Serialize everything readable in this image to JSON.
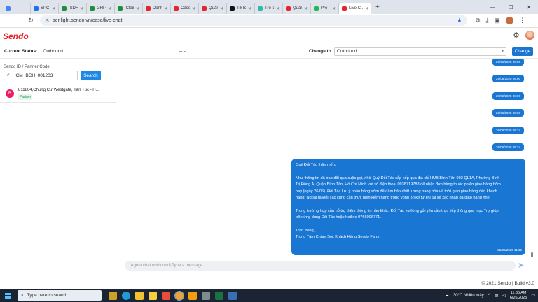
{
  "browser": {
    "tabs": [
      {
        "label": "",
        "color": "#4285f4",
        "type": "gmail",
        "active": false
      },
      {
        "label": "SPC - ...",
        "color": "#1a73e8",
        "active": false
      },
      {
        "label": "[SDF C...",
        "color": "#1e8e3e",
        "active": false
      },
      {
        "label": "GHI C...",
        "color": "#1e8e3e",
        "active": false
      },
      {
        "label": "[Claim...",
        "color": "#1e8e3e",
        "active": false
      },
      {
        "label": "Danh ...",
        "color": "#e4262c",
        "active": false
      },
      {
        "label": "Case ...",
        "color": "#e4262c",
        "active": false
      },
      {
        "label": "Quản ...",
        "color": "#e4262c",
        "active": false
      },
      {
        "label": "TikTok",
        "color": "#111111",
        "active": false
      },
      {
        "label": "Trò ch...",
        "color": "#2bbbad",
        "active": false
      },
      {
        "label": "Quản ...",
        "color": "#e4262c",
        "active": false
      },
      {
        "label": "Pre - ...",
        "color": "#1db954",
        "active": false
      },
      {
        "label": "Live C...",
        "color": "#e4262c",
        "active": true
      }
    ],
    "url": "senlight.sendo.vn/case/live-chat"
  },
  "app": {
    "logo": "Sendo",
    "status_label": "Current Status:",
    "status_value": "Outbound",
    "timer": "--:--",
    "change_to_label": "Change to",
    "change_to_value": "Outbound",
    "change_button": "Change"
  },
  "left_panel": {
    "search_label": "Sendo ID / Partner Code:",
    "search_value": "HCM_BCH_001203",
    "search_button": "Search",
    "items": [
      {
        "avatar": "B",
        "title": "811804,Chung Cư Westgate, Tân Túc - H...",
        "tag": "Partner"
      }
    ]
  },
  "chat": {
    "small_bubbles": [
      "26/06/2025 07:08",
      "26/06/2025 08:00",
      "26/06/2025 08:00",
      "26/06/2025 08:00",
      "26/06/2025 08:00",
      "26/06/2025 08:34",
      "26/06/2025 08:34"
    ],
    "message": {
      "lines": [
        "Quý Đối Tác thân mến,",
        "",
        "Như thông tin đã trao đổi qua cuộc gọi, nhờ Quý Đối Tác sắp xếp qua địa chỉ HUB Bình Tân 902 QL1A, Phường Bình",
        "Trị Đông A, Quận Bình Tân, Hồ Chí Minh với số điện thoại 0938719783 để nhận đơn hàng thuộc phiên giao hàng hôm",
        "nay (ngày 26/06). Đối Tác lưu ý nhận hàng sớm để đảm bảo chất lượng hàng hóa và thời gian giao hàng đến khách",
        "hàng. Ngoài ra Đối Tác cũng cần thực hiện kiểm hàng trong vòng 3h kể từ khi tài xế xác nhận đã giao hàng nhé.",
        "",
        "Trong trường hợp cần hỗ trợ thêm thông tin nào khác, Đối Tác vui lòng gửi yêu cầu trực tiếp thông qua mục Trợ giúp",
        "trên ứng dụng Đối Tác hoặc hotline 0766006771.",
        "",
        "Trân trọng,",
        "Trung Tâm Chăm Sóc Khách Hàng Sendo Farm"
      ],
      "timestamp": "26/06/2025 11:35"
    },
    "compose_placeholder": "[Agent chat outbound] Type a message..."
  },
  "footer": {
    "text": "© 2021 Sendo | Build v3.0"
  },
  "taskbar": {
    "search_placeholder": "Type here to search",
    "weather": "30°C  Nhiều mây",
    "time": "11:35 AM",
    "date": "6/26/2025"
  },
  "colors": {
    "brand": "#e4262c",
    "primary": "#1976d2"
  }
}
